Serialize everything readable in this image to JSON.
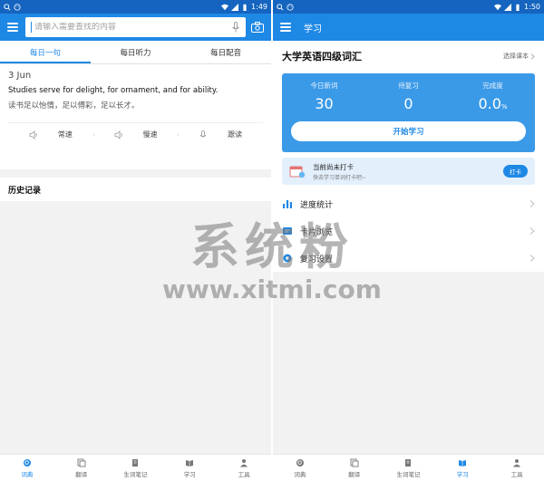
{
  "status_left": {
    "time": "1:49",
    "battery_text": ""
  },
  "status_right": {
    "time": "1:50"
  },
  "left": {
    "search_placeholder": "请输入需要查找的内容",
    "tabs": [
      "每日一句",
      "每日听力",
      "每日配音"
    ],
    "daily": {
      "date": "3 Jun",
      "english": "Studies serve for delight, for ornament, and for ability.",
      "chinese": "读书足以怡情，足以傅彩，足以长才。"
    },
    "actions": [
      "常速",
      "慢速",
      "跟读"
    ],
    "history_title": "历史记录"
  },
  "right": {
    "title": "学习",
    "book_title": "大学英语四级词汇",
    "select_book": "选择课本",
    "stats": [
      {
        "label": "今日新词",
        "value": "30",
        "unit": ""
      },
      {
        "label": "待复习",
        "value": "0",
        "unit": ""
      },
      {
        "label": "完成度",
        "value": "0.0",
        "unit": "%"
      }
    ],
    "start_button": "开始学习",
    "checkin": {
      "title": "当前尚未打卡",
      "subtitle": "快去学习单词打卡吧~",
      "button": "打卡"
    },
    "menu": [
      "进度统计",
      "卡片浏览",
      "复习设置"
    ]
  },
  "nav": [
    "词典",
    "翻译",
    "生词笔记",
    "学习",
    "工具"
  ],
  "watermark": {
    "main": "系统粉",
    "url": "www.xitmi.com"
  },
  "colors": {
    "primary": "#1e88e5",
    "statusbar": "#1565c0",
    "card": "#3b9ae8"
  }
}
